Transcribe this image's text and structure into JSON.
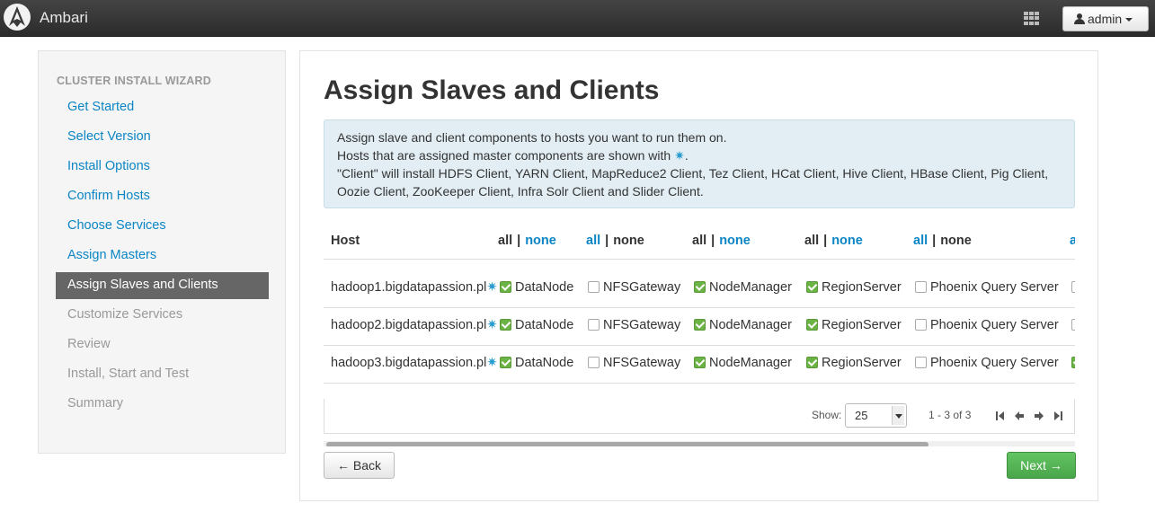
{
  "navbar": {
    "brand": "Ambari",
    "user_label": "admin"
  },
  "sidebar": {
    "title": "CLUSTER INSTALL WIZARD",
    "steps": [
      {
        "label": "Get Started",
        "state": "done"
      },
      {
        "label": "Select Version",
        "state": "done"
      },
      {
        "label": "Install Options",
        "state": "done"
      },
      {
        "label": "Confirm Hosts",
        "state": "done"
      },
      {
        "label": "Choose Services",
        "state": "done"
      },
      {
        "label": "Assign Masters",
        "state": "done"
      },
      {
        "label": "Assign Slaves and Clients",
        "state": "active"
      },
      {
        "label": "Customize Services",
        "state": "disabled"
      },
      {
        "label": "Review",
        "state": "disabled"
      },
      {
        "label": "Install, Start and Test",
        "state": "disabled"
      },
      {
        "label": "Summary",
        "state": "disabled"
      }
    ]
  },
  "main": {
    "title": "Assign Slaves and Clients",
    "alert": {
      "line1": "Assign slave and client components to hosts you want to run them on.",
      "line2_prefix": "Hosts that are assigned master components are shown with ",
      "line2_star": "✷",
      "line2_suffix": ".",
      "line3": "\"Client\" will install HDFS Client, YARN Client, MapReduce2 Client, Tez Client, HCat Client, Hive Client, HBase Client, Pig Client, Oozie Client, ZooKeeper Client, Infra Solr Client and Slider Client."
    },
    "table": {
      "host_header": "Host",
      "all_label": "all",
      "none_label": "none",
      "separator": "|",
      "partial_label": "a",
      "rows": [
        {
          "host": "hadoop1.bigdatapassion.pl",
          "star": "✷",
          "components": [
            "DataNode",
            "NFSGateway",
            "NodeManager",
            "RegionServer",
            "Phoenix Query Server"
          ],
          "checked": [
            true,
            false,
            true,
            true,
            false,
            false
          ]
        },
        {
          "host": "hadoop2.bigdatapassion.pl",
          "star": "✷",
          "components": [
            "DataNode",
            "NFSGateway",
            "NodeManager",
            "RegionServer",
            "Phoenix Query Server"
          ],
          "checked": [
            true,
            false,
            true,
            true,
            false,
            false
          ]
        },
        {
          "host": "hadoop3.bigdatapassion.pl",
          "star": "✷",
          "components": [
            "DataNode",
            "NFSGateway",
            "NodeManager",
            "RegionServer",
            "Phoenix Query Server"
          ],
          "checked": [
            true,
            false,
            true,
            true,
            false,
            true
          ]
        }
      ]
    },
    "pager": {
      "show_label": "Show:",
      "page_size": "25",
      "range": "1 - 3 of 3"
    },
    "back_label": "← Back",
    "next_label": "Next →"
  },
  "colors": {
    "link": "#0b85c4",
    "active_step_bg": "#666666",
    "checkbox_checked": "#6cb345",
    "next_button": "#4aa54a",
    "alert_bg": "#e2eef4"
  }
}
